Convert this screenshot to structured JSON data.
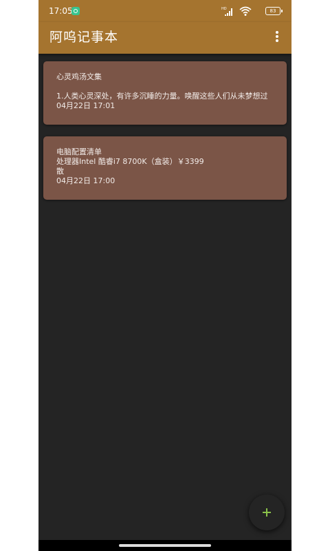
{
  "status_bar": {
    "time": "17:05",
    "battery": "83",
    "icons": [
      "app-notification-icon",
      "signal-icon",
      "wifi-icon",
      "battery-icon"
    ]
  },
  "app_bar": {
    "title": "阿呜记事本",
    "menu_icon": "more-vert-icon"
  },
  "notes": [
    {
      "title": "心灵鸡汤文集",
      "body": "1.人类心灵深处，有许多沉睡的力量。唤醒这些人们从未梦想过",
      "date": "04月22日 17:01"
    },
    {
      "title": "电脑配置清单",
      "line1": "处理器Intel 酷睿i7 8700K（盒装）￥3399",
      "line2": "散",
      "date": "04月22日 17:00"
    }
  ],
  "fab": {
    "icon": "plus-icon"
  },
  "colors": {
    "toolbar": "#a5742f",
    "background": "#242424",
    "card": "#7b5547",
    "fab_plus": "#8bc34a"
  }
}
